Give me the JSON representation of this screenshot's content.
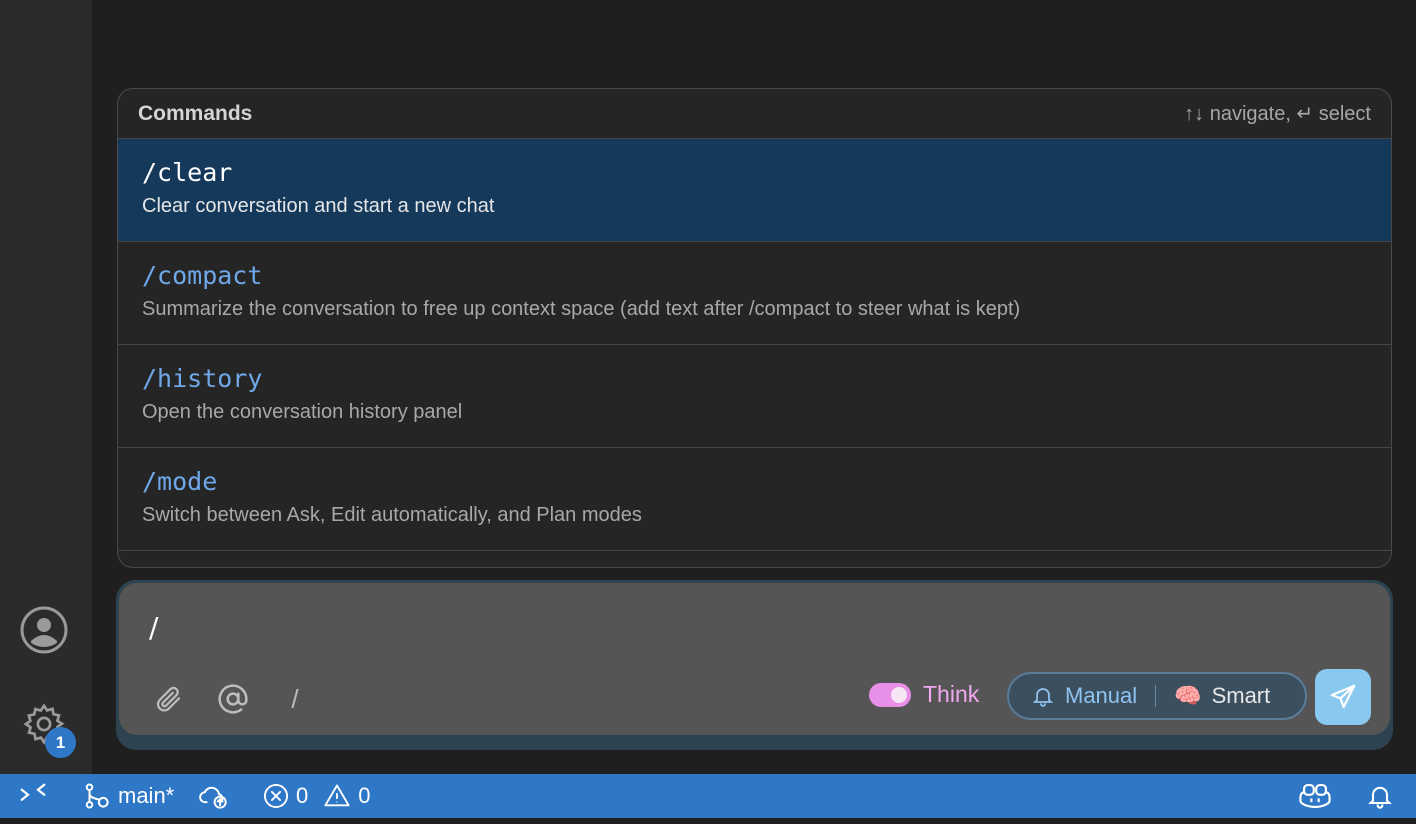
{
  "commands": {
    "title": "Commands",
    "hint": "↑↓ navigate, ↵ select",
    "items": [
      {
        "name": "/clear",
        "description": "Clear conversation and start a new chat"
      },
      {
        "name": "/compact",
        "description": "Summarize the conversation to free up context space (add text after /compact to steer what is kept)"
      },
      {
        "name": "/history",
        "description": "Open the conversation history panel"
      },
      {
        "name": "/mode",
        "description": "Switch between Ask, Edit automatically, and Plan modes"
      }
    ]
  },
  "input": {
    "value": "/",
    "slash_label": "/"
  },
  "toolbar": {
    "think_label": "Think",
    "think_enabled": true,
    "mode_manual_label": "Manual",
    "mode_smart_label": "Smart",
    "smart_emoji": "🧠"
  },
  "activity": {
    "settings_badge": "1"
  },
  "status": {
    "branch": "main*",
    "errors": "0",
    "warnings": "0"
  },
  "colors": {
    "status_bar": "#2f78c8",
    "selected_row": "#15395b",
    "command_name": "#6fa8e8",
    "think_accent": "#f0a8f0",
    "send_button": "#89c8ef"
  }
}
